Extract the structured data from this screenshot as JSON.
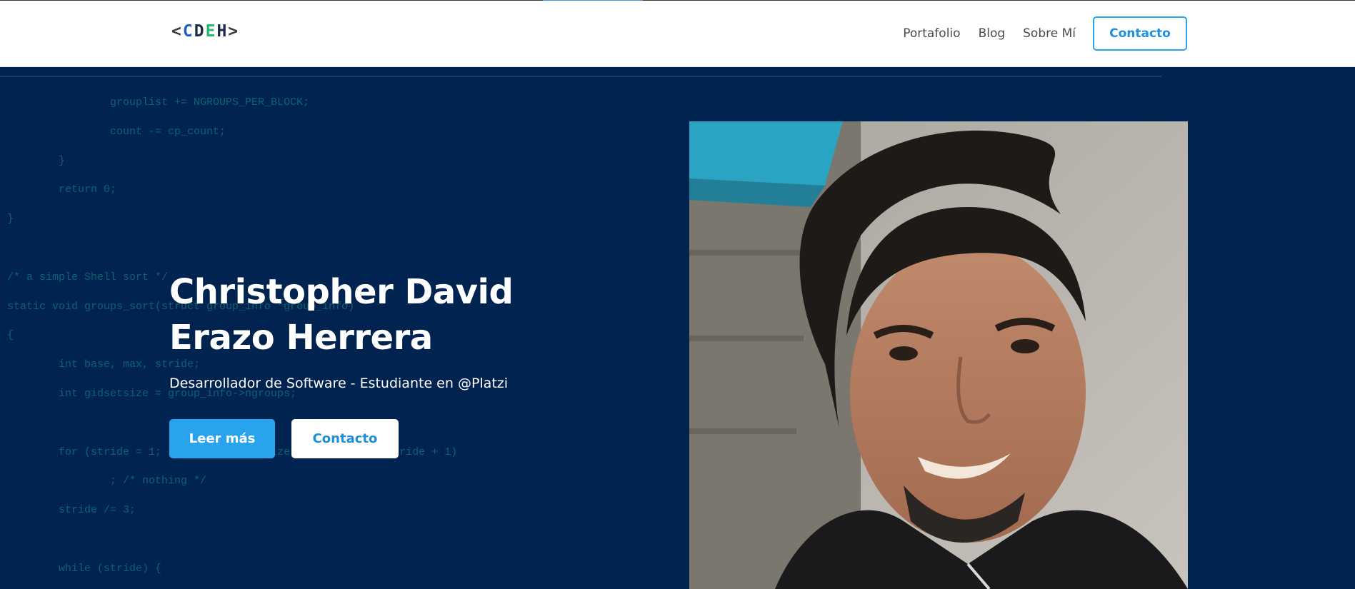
{
  "logo": {
    "text": [
      "<",
      "C",
      "D",
      "E",
      "H",
      ">"
    ],
    "colors": [
      "#3b3b3b",
      "#1f5fbf",
      "#1b2a4a",
      "#2bb673",
      "#1b2a4a",
      "#3b3b3b"
    ]
  },
  "nav": {
    "items": [
      "Portafolio",
      "Blog",
      "Sobre Mí"
    ],
    "cta": "Contacto"
  },
  "hero": {
    "title": "Christopher David Erazo Herrera",
    "subtitle": "Desarrollador de Software - Estudiante en @Platzi",
    "primary_button": "Leer más",
    "secondary_button": "Contacto",
    "code_lines": [
      "                grouplist += NGROUPS_PER_BLOCK;",
      "                count -= cp_count;",
      "        }",
      "        return 0;",
      "}",
      "",
      "/* a simple Shell sort */",
      "static void groups_sort(struct group_info *group_info)",
      "{",
      "        int base, max, stride;",
      "        int gidsetsize = group_info->ngroups;",
      "",
      "        for (stride = 1; stride < gidsetsize; stride = 3 * stride + 1)",
      "                ; /* nothing */",
      "        stride /= 3;",
      "",
      "        while (stride) {"
    ]
  },
  "colors": {
    "hero_bg": "#012350",
    "accent": "#2aa3ef",
    "code": "#0f6a74"
  }
}
